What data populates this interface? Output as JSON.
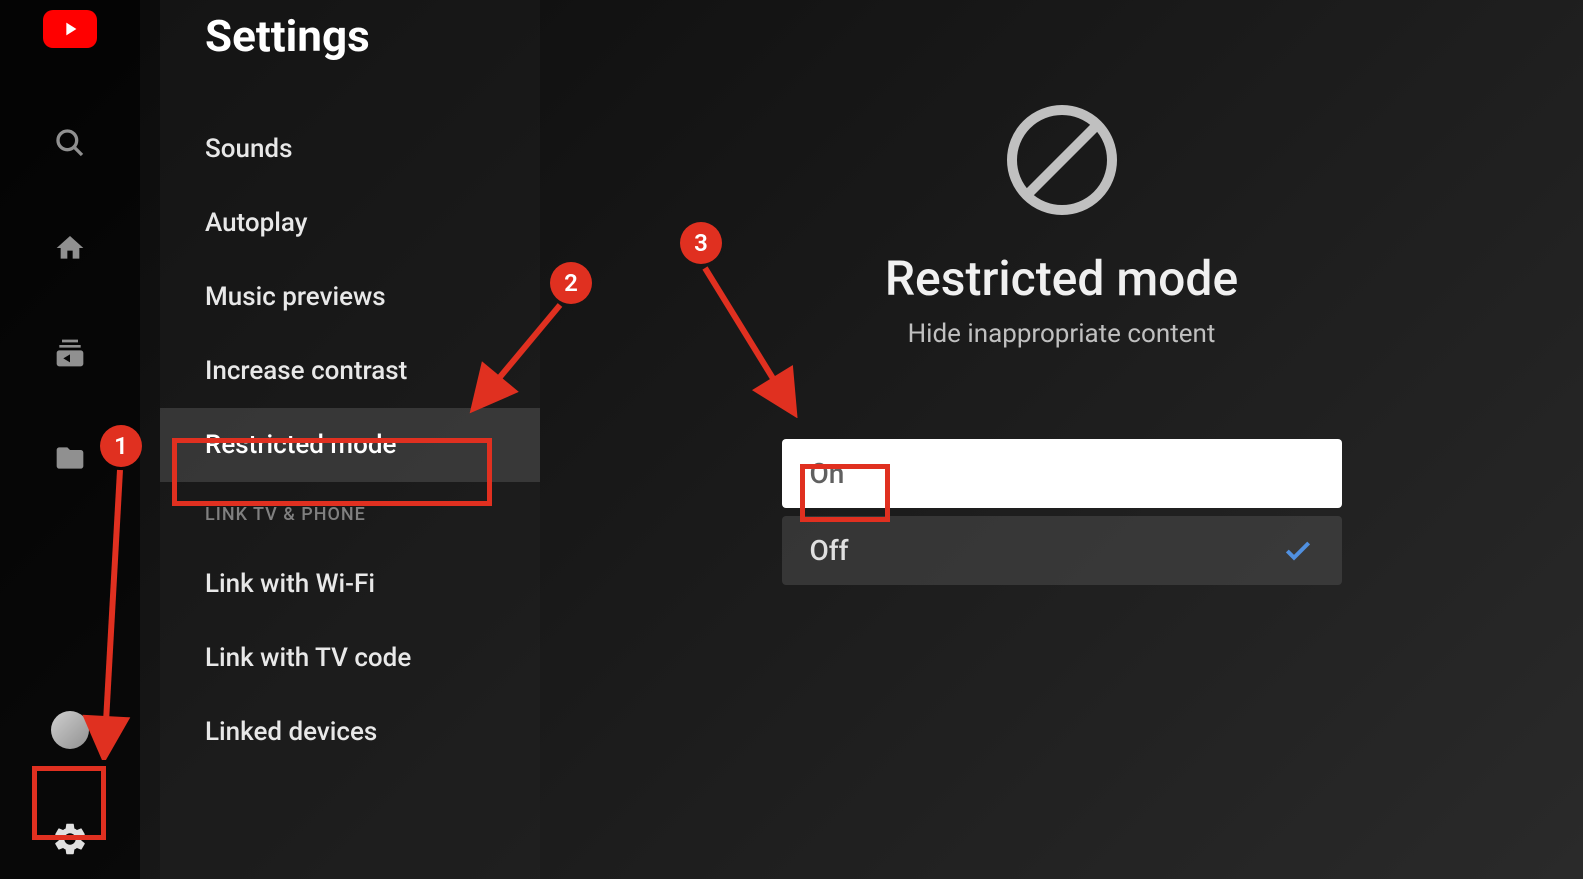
{
  "rail": {
    "logo": "youtube-logo"
  },
  "settings": {
    "title": "Settings",
    "items": [
      {
        "label": "Sounds"
      },
      {
        "label": "Autoplay"
      },
      {
        "label": "Music previews"
      },
      {
        "label": "Increase contrast"
      },
      {
        "label": "Restricted mode"
      }
    ],
    "section_header": "LINK TV & PHONE",
    "link_items": [
      {
        "label": "Link with Wi-Fi"
      },
      {
        "label": "Link with TV code"
      },
      {
        "label": "Linked devices"
      }
    ]
  },
  "detail": {
    "title": "Restricted mode",
    "subtitle": "Hide inappropriate content",
    "options": {
      "on": "On",
      "off": "Off"
    }
  },
  "annotations": {
    "step1": "1",
    "step2": "2",
    "step3": "3"
  }
}
